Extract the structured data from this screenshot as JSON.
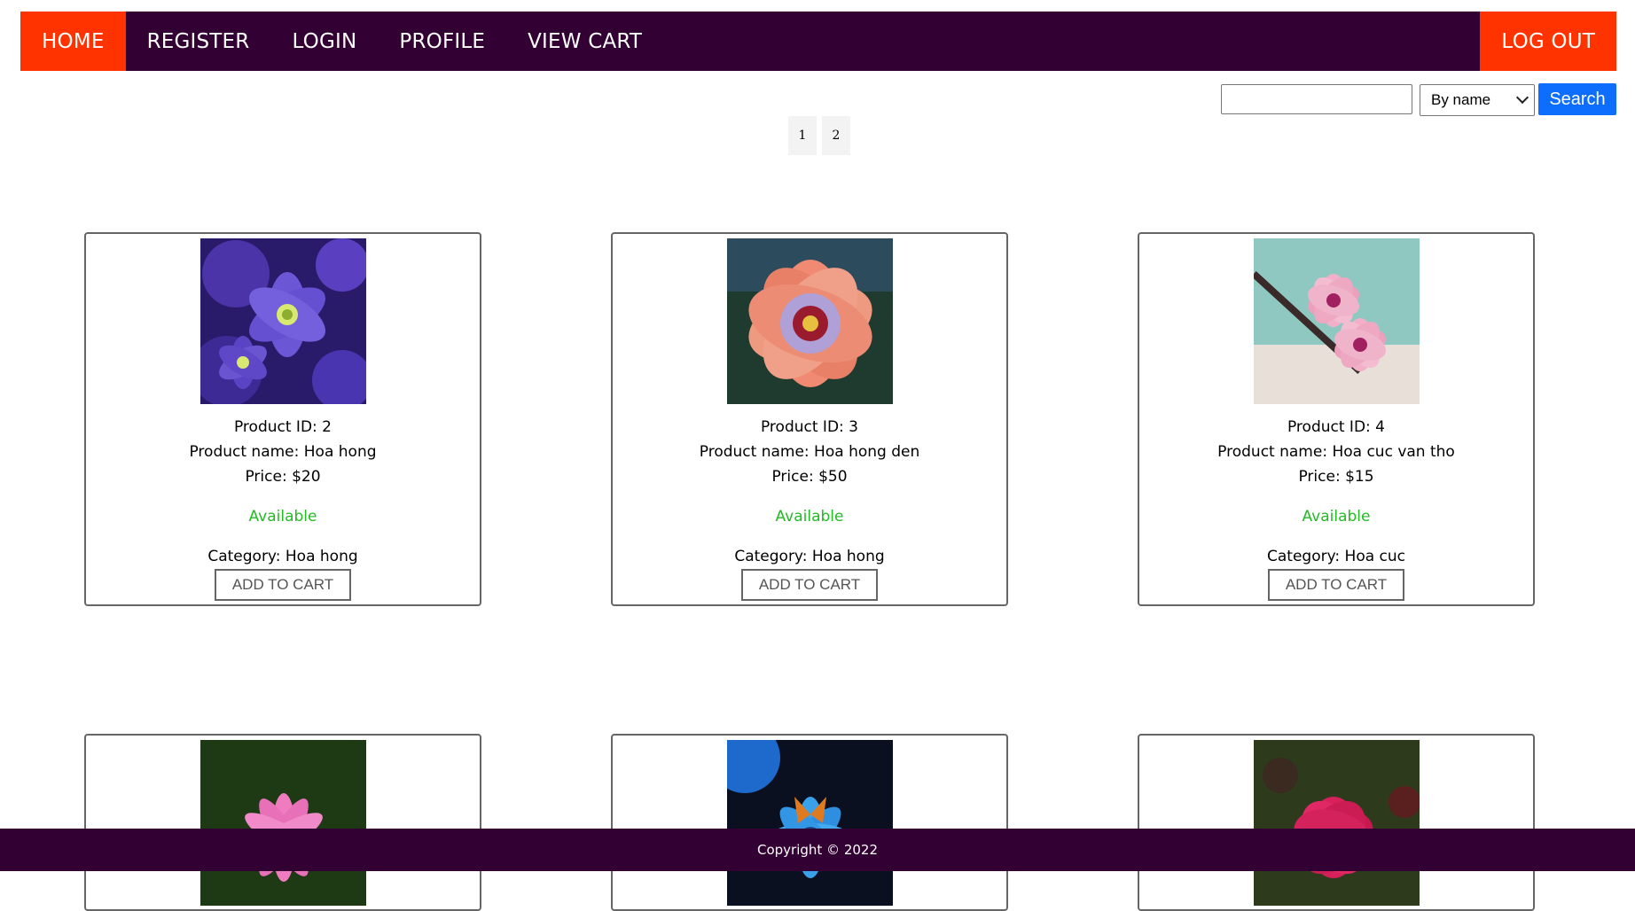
{
  "nav": {
    "home": "HOME",
    "register": "REGISTER",
    "login": "LOGIN",
    "profile": "PROFILE",
    "view_cart": "VIEW CART",
    "logout": "LOG OUT"
  },
  "search": {
    "value": "",
    "sort_selected": "By name",
    "button_label": "Search"
  },
  "pagination": [
    "1",
    "2"
  ],
  "products": [
    {
      "id_text": "Product ID: 2",
      "name_text": "Product name: Hoa hong",
      "price_text": "Price: $20",
      "status": "Available",
      "category_text": "Category: Hoa hong",
      "button": "ADD TO CART",
      "image": "purple-flower"
    },
    {
      "id_text": "Product ID: 3",
      "name_text": "Product name: Hoa hong den",
      "price_text": "Price: $50",
      "status": "Available",
      "category_text": "Category: Hoa hong",
      "button": "ADD TO CART",
      "image": "hibiscus-flower"
    },
    {
      "id_text": "Product ID: 4",
      "name_text": "Product name: Hoa cuc van tho",
      "price_text": "Price: $15",
      "status": "Available",
      "category_text": "Category: Hoa cuc",
      "button": "ADD TO CART",
      "image": "pink-blossom"
    },
    {
      "image": "lotus-flower"
    },
    {
      "image": "blue-flower-butterfly"
    },
    {
      "image": "red-hibiscus"
    }
  ],
  "colors": {
    "nav_bg": "#330033",
    "nav_active": "#ff3300",
    "available": "#22bb22",
    "search_button": "#0d6efd"
  },
  "footer": {
    "text": "Copyright © 2022"
  }
}
